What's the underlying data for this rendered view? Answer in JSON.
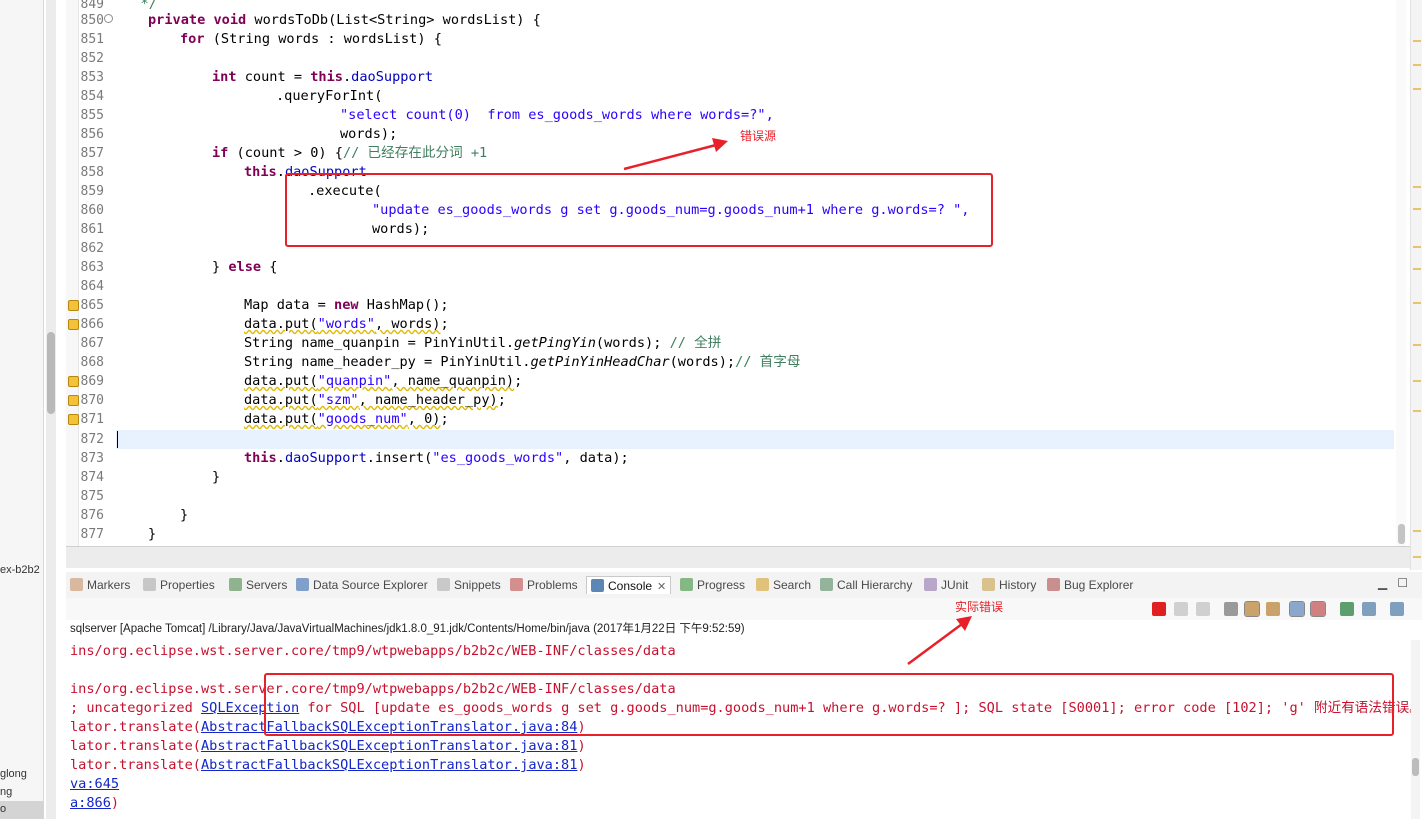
{
  "left_panel": {
    "project_labels": [
      "ex-b2b2",
      "glong",
      "ng",
      "o"
    ]
  },
  "editor": {
    "lines": [
      {
        "n": "849",
        "text": "   */"
      },
      {
        "n": "850",
        "text": "private void wordsToDb(List<String> wordsList) {"
      },
      {
        "n": "851",
        "text": "for (String words : wordsList) {"
      },
      {
        "n": "852",
        "text": ""
      },
      {
        "n": "853",
        "text": "int count = this.daoSupport"
      },
      {
        "n": "854",
        "text": ".queryForInt("
      },
      {
        "n": "855",
        "text": "\"select count(0)  from es_goods_words where words=?\","
      },
      {
        "n": "856",
        "text": "words);"
      },
      {
        "n": "857",
        "text": "if (count > 0) {// 已经存在此分词 +1"
      },
      {
        "n": "858",
        "text": "this.daoSupport"
      },
      {
        "n": "859",
        "text": ".execute("
      },
      {
        "n": "860",
        "text": "\"update es_goods_words g set g.goods_num=g.goods_num+1 where g.words=? \","
      },
      {
        "n": "861",
        "text": "words);"
      },
      {
        "n": "862",
        "text": ""
      },
      {
        "n": "863",
        "text": "} else {"
      },
      {
        "n": "864",
        "text": ""
      },
      {
        "n": "865",
        "text": "Map data = new HashMap();"
      },
      {
        "n": "866",
        "text": "data.put(\"words\", words);"
      },
      {
        "n": "867",
        "text": "String name_quanpin = PinYinUtil.getPingYin(words); // 全拼"
      },
      {
        "n": "868",
        "text": "String name_header_py = PinYinUtil.getPinYinHeadChar(words);// 首字母"
      },
      {
        "n": "869",
        "text": "data.put(\"quanpin\", name_quanpin);"
      },
      {
        "n": "870",
        "text": "data.put(\"szm\", name_header_py);"
      },
      {
        "n": "871",
        "text": "data.put(\"goods_num\", 0);"
      },
      {
        "n": "872",
        "text": ""
      },
      {
        "n": "873",
        "text": "this.daoSupport.insert(\"es_goods_words\", data);"
      },
      {
        "n": "874",
        "text": "}"
      },
      {
        "n": "875",
        "text": ""
      },
      {
        "n": "876",
        "text": "}"
      },
      {
        "n": "877",
        "text": "}"
      }
    ]
  },
  "view_tabs": [
    "Markers",
    "Properties",
    "Servers",
    "Data Source Explorer",
    "Snippets",
    "Problems",
    "Console",
    "Progress",
    "Search",
    "Call Hierarchy",
    "JUnit",
    "History",
    "Bug Explorer"
  ],
  "view_tab_icons": [
    "markers-icon",
    "properties-icon",
    "servers-icon",
    "data-source-icon",
    "snippets-icon",
    "problems-icon",
    "console-icon",
    "progress-icon",
    "search-icon",
    "call-hierarchy-icon",
    "junit-icon",
    "history-icon",
    "bug-explorer-icon"
  ],
  "active_tab": "Console",
  "console": {
    "header": "sqlserver [Apache Tomcat] /Library/Java/JavaVirtualMachines/jdk1.8.0_91.jdk/Contents/Home/bin/java (2017年1月22日 下午9:52:59)",
    "line1": "ins/org.eclipse.wst.server.core/tmp9/wtpwebapps/b2b2c/WEB-INF/classes/data",
    "line2": "ins/org.eclipse.wst.server.core/tmp9/wtpwebapps/b2b2c/WEB-INF/classes/data",
    "line3_pre": "; uncategorized ",
    "line3_link": "SQLException",
    "line3_post": " for SQL [update es_goods_words g set g.goods_num=g.goods_num+1 where g.words=? ]; SQL state [S0001]; error code [102]; 'g' 附近有语法错误。; n",
    "line4_pre": "lator.translate(",
    "line4_link": "AbstractFallbackSQLExceptionTranslator.java:84",
    "line4_post": ")",
    "line5_pre": "lator.translate(",
    "line5_link": "AbstractFallbackSQLExceptionTranslator.java:81",
    "line5_post": ")",
    "line6_pre": "lator.translate(",
    "line6_link": "AbstractFallbackSQLExceptionTranslator.java:81",
    "line6_post": ")",
    "line7_link": "va:645",
    "line8_link": "a:866",
    "line8_post": ")",
    "toolbar_icons": [
      "terminate-icon",
      "remove-launch-icon",
      "remove-all-icon",
      "clear-console-icon",
      "scroll-lock-icon",
      "word-wrap-icon",
      "show-on-stdout-icon",
      "show-on-stderr-icon",
      "pin-console-icon",
      "display-console-icon",
      "open-console-icon"
    ]
  },
  "annotations": {
    "error_source": "错误源",
    "actual_error": "实际错误",
    "color": "#e8202a"
  },
  "colors": {
    "keyword": "#7f0055",
    "field": "#0000c0",
    "string": "#2a00ff",
    "comment": "#3f7f5f",
    "console_error": "#c8102e",
    "console_link": "#1426c8"
  }
}
